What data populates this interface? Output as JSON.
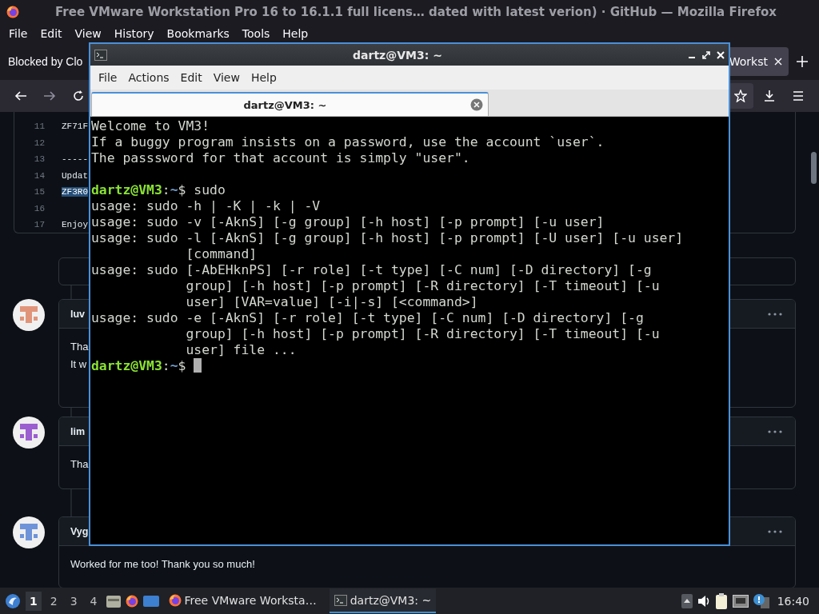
{
  "browser": {
    "title": "Free VMware Workstation Pro 16 to 16.1.1 full licens…  dated with latest verion) · GitHub — Mozilla Firefox",
    "menu": [
      "File",
      "Edit",
      "View",
      "History",
      "Bookmarks",
      "Tools",
      "Help"
    ],
    "tabs": [
      {
        "label": "Blocked by Clo",
        "selected": false
      },
      {
        "label": "Workst",
        "selected": true
      }
    ]
  },
  "page": {
    "code_lines": [
      {
        "number": "11",
        "text": "ZF71F",
        "highlighted": false
      },
      {
        "number": "12"
      },
      {
        "number": "13",
        "text": "-----",
        "highlighted": false
      },
      {
        "number": "14",
        "text": "Updat",
        "highlighted": false
      },
      {
        "number": "15",
        "text": "ZF3R0",
        "highlighted": true
      },
      {
        "number": "16"
      },
      {
        "number": "17",
        "text": "Enjoy",
        "highlighted": false
      }
    ],
    "comments": [
      {
        "author": "luv",
        "color": "#e0957a",
        "lines": [
          "Tha",
          "It w"
        ]
      },
      {
        "author": "lim",
        "color": "#9b5fd0",
        "lines": [
          "Tha"
        ]
      },
      {
        "author": "Vyg",
        "color": "#6f93d8",
        "lines": [
          "Worked for me too! Thank you so much!"
        ]
      }
    ]
  },
  "terminal": {
    "title": "dartz@VM3: ~",
    "menu": [
      "File",
      "Actions",
      "Edit",
      "View",
      "Help"
    ],
    "tabs": [
      {
        "label": "dartz@VM3: ~",
        "selected": true
      }
    ],
    "lines": [
      {
        "kind": "output",
        "text": "Welcome to VM3!"
      },
      {
        "kind": "output",
        "text": "If a buggy program insists on a password, use the account `user`."
      },
      {
        "kind": "output",
        "text": "The passsword for that account is simply \"user\"."
      },
      {
        "kind": "blank"
      },
      {
        "kind": "prompt",
        "user": "dartz@VM3",
        "separator": ":",
        "path": "~",
        "symbol": "$",
        "command": "sudo"
      },
      {
        "kind": "output",
        "text": "usage: sudo -h | -K | -k | -V"
      },
      {
        "kind": "output",
        "text": "usage: sudo -v [-AknS] [-g group] [-h host] [-p prompt] [-u user]"
      },
      {
        "kind": "output",
        "text": "usage: sudo -l [-AknS] [-g group] [-h host] [-p prompt] [-U user] [-u user]"
      },
      {
        "kind": "output",
        "text": "            [command]"
      },
      {
        "kind": "output",
        "text": "usage: sudo [-AbEHknPS] [-r role] [-t type] [-C num] [-D directory] [-g"
      },
      {
        "kind": "output",
        "text": "            group] [-h host] [-p prompt] [-R directory] [-T timeout] [-u"
      },
      {
        "kind": "output",
        "text": "            user] [VAR=value] [-i|-s] [<command>]"
      },
      {
        "kind": "output",
        "text": "usage: sudo -e [-AknS] [-r role] [-t type] [-C num] [-D directory] [-g"
      },
      {
        "kind": "output",
        "text": "            group] [-h host] [-p prompt] [-R directory] [-T timeout] [-u"
      },
      {
        "kind": "output",
        "text": "            user] file ..."
      },
      {
        "kind": "prompt",
        "user": "dartz@VM3",
        "separator": ":",
        "path": "~",
        "symbol": "$",
        "cursor": true
      }
    ]
  },
  "taskbar": {
    "workspaces": [
      {
        "label": "1",
        "selected": true
      },
      {
        "label": "2",
        "selected": false
      },
      {
        "label": "3",
        "selected": false
      },
      {
        "label": "4",
        "selected": false
      }
    ],
    "tasks": [
      {
        "kind": "browser",
        "label": "Free VMware Worksta…",
        "selected": false
      },
      {
        "kind": "terminal",
        "label": "dartz@VM3: ~",
        "selected": true
      }
    ],
    "clock": "16:40"
  }
}
